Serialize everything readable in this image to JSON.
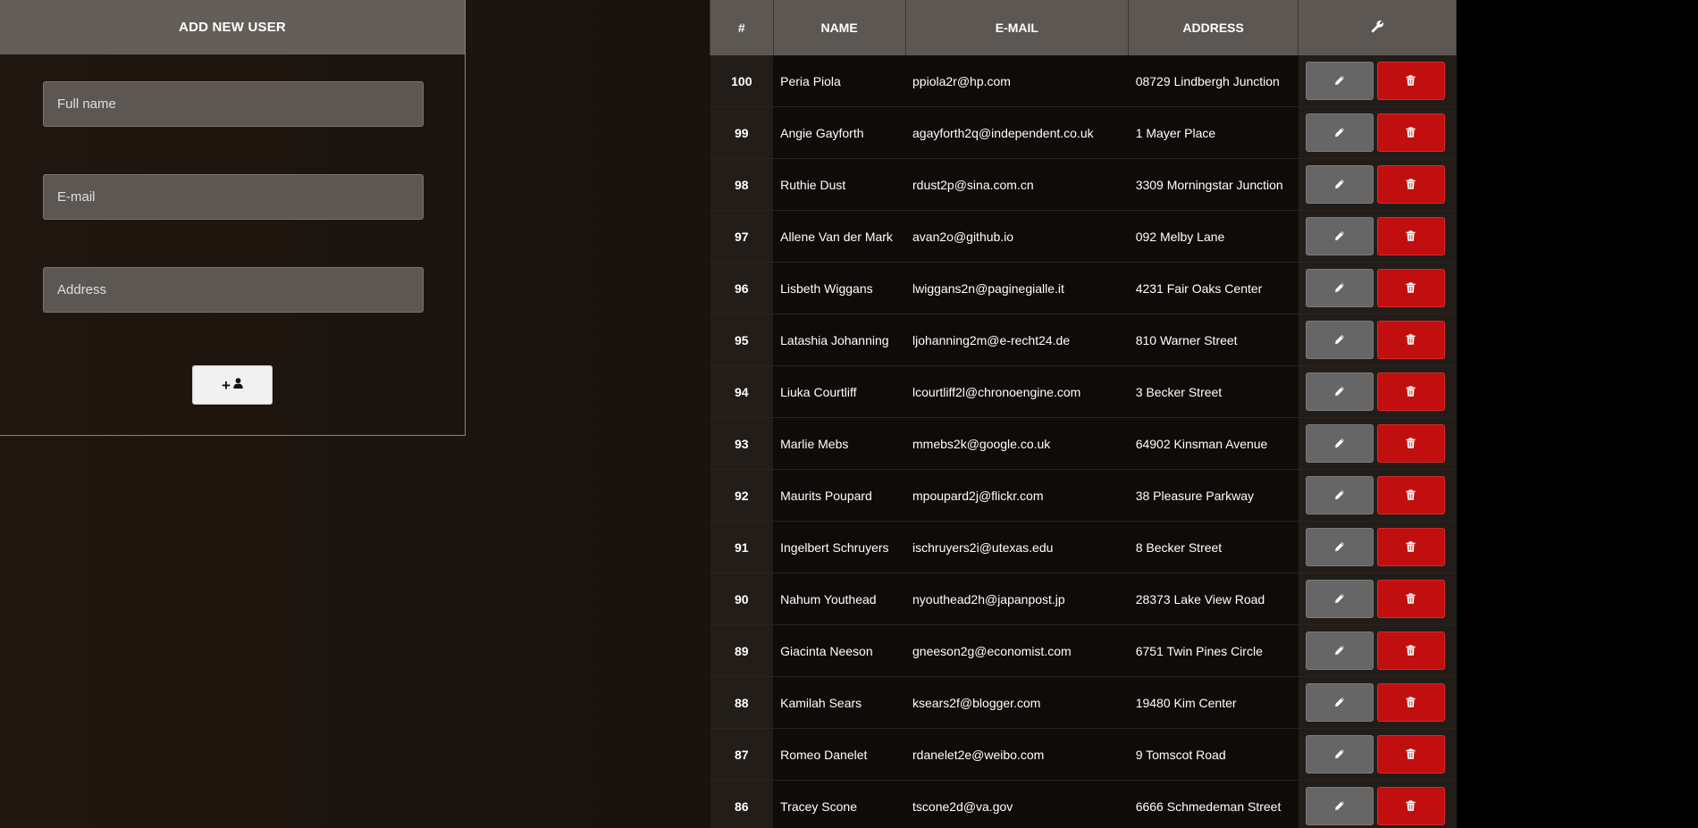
{
  "add_user": {
    "title": "ADD NEW USER",
    "name_placeholder": "Full name",
    "email_placeholder": "E-mail",
    "address_placeholder": "Address",
    "add_button_icon": "add-user-icon"
  },
  "table": {
    "headers": {
      "id": "#",
      "name": "NAME",
      "email": "E-MAIL",
      "address": "ADDRESS",
      "actions_icon": "wrench-icon"
    },
    "rows": [
      {
        "id": "100",
        "name": "Peria Piola",
        "email": "ppiola2r@hp.com",
        "address": "08729 Lindbergh Junction"
      },
      {
        "id": "99",
        "name": "Angie Gayforth",
        "email": "agayforth2q@independent.co.uk",
        "address": "1 Mayer Place"
      },
      {
        "id": "98",
        "name": "Ruthie Dust",
        "email": "rdust2p@sina.com.cn",
        "address": "3309 Morningstar Junction"
      },
      {
        "id": "97",
        "name": "Allene Van der Mark",
        "email": "avan2o@github.io",
        "address": "092 Melby Lane"
      },
      {
        "id": "96",
        "name": "Lisbeth Wiggans",
        "email": "lwiggans2n@paginegialle.it",
        "address": "4231 Fair Oaks Center"
      },
      {
        "id": "95",
        "name": "Latashia Johanning",
        "email": "ljohanning2m@e-recht24.de",
        "address": "810 Warner Street"
      },
      {
        "id": "94",
        "name": "Liuka Courtliff",
        "email": "lcourtliff2l@chronoengine.com",
        "address": "3 Becker Street"
      },
      {
        "id": "93",
        "name": "Marlie Mebs",
        "email": "mmebs2k@google.co.uk",
        "address": "64902 Kinsman Avenue"
      },
      {
        "id": "92",
        "name": "Maurits Poupard",
        "email": "mpoupard2j@flickr.com",
        "address": "38 Pleasure Parkway"
      },
      {
        "id": "91",
        "name": "Ingelbert Schruyers",
        "email": "ischruyers2i@utexas.edu",
        "address": "8 Becker Street"
      },
      {
        "id": "90",
        "name": "Nahum Youthead",
        "email": "nyouthead2h@japanpost.jp",
        "address": "28373 Lake View Road"
      },
      {
        "id": "89",
        "name": "Giacinta Neeson",
        "email": "gneeson2g@economist.com",
        "address": "6751 Twin Pines Circle"
      },
      {
        "id": "88",
        "name": "Kamilah Sears",
        "email": "ksears2f@blogger.com",
        "address": "19480 Kim Center"
      },
      {
        "id": "87",
        "name": "Romeo Danelet",
        "email": "rdanelet2e@weibo.com",
        "address": "9 Tomscot Road"
      },
      {
        "id": "86",
        "name": "Tracey Scone",
        "email": "tscone2d@va.gov",
        "address": "6666 Schmedeman Street"
      }
    ],
    "edit_icon": "pencil-icon",
    "delete_icon": "trash-icon"
  },
  "colors": {
    "header_bg": "#5c5753",
    "edit_button": "#666666",
    "delete_button": "#c10f0f",
    "page_bg": "#1c140e"
  }
}
